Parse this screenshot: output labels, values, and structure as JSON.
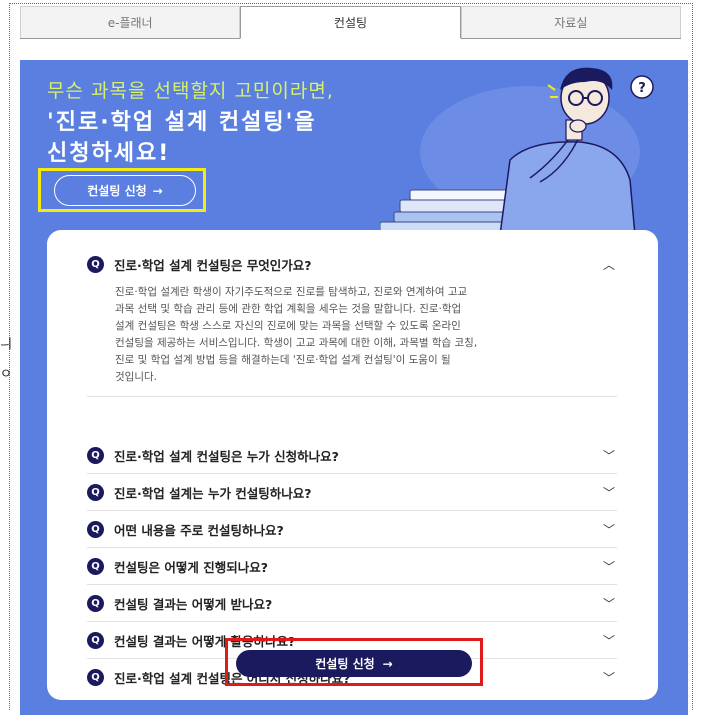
{
  "tabs": [
    {
      "label": "e-플래너"
    },
    {
      "label": "컨설팅"
    },
    {
      "label": "자료실"
    }
  ],
  "side_glyphs": [
    "ㅢ",
    "ㅇ"
  ],
  "hero": {
    "line1": "무슨 과목을 선택할지 고민이라면,",
    "line2": "'진로·학업 설계 컨설팅'을",
    "line3": "신청하세요!",
    "cta_label": "컨설팅 신청",
    "cta_arrow": "→",
    "bubble": "?"
  },
  "faq": {
    "badge": "Q",
    "items": [
      {
        "question": "진로·학업 설계 컨설팅은 무엇인가요?",
        "expanded": true,
        "answer": "진로·학업 설계란 학생이 자기주도적으로 진로를 탐색하고, 진로와 연계하여 고교\n과목 선택 및 학습 관리 등에 관한 학업 계획을 세우는 것을 말합니다. 진로·학업\n설계 컨설팅은 학생 스스로 자신의 진로에 맞는 과목을 선택할 수 있도록 온라인\n컨설팅을 제공하는 서비스입니다. 학생이 고교 과목에 대한 이해, 과목별 학습 코칭,\n진로 및 학업 설계 방법 등을 해결하는데 '진로·학업 설계 컨설팅'이 도움이 될\n것입니다."
      },
      {
        "question": "진로·학업 설계 컨설팅은 누가 신청하나요?"
      },
      {
        "question": "진로·학업 설계는 누가 컨설팅하나요?"
      },
      {
        "question": "어떤 내용을 주로 컨설팅하나요?"
      },
      {
        "question": "컨설팅은 어떻게 진행되나요?"
      },
      {
        "question": "컨설팅 결과는 어떻게 받나요?"
      },
      {
        "question": "컨설팅 결과는 어떻게 활용하나요?"
      },
      {
        "question": "진로·학업 설계 컨설팅은 어디서 신청하나요?"
      }
    ],
    "chevron_up": "︿",
    "chevron_down": "﹀"
  },
  "bottom_cta": {
    "label": "컨설팅 신청",
    "arrow": "→"
  },
  "colors": {
    "panel": "#5b7fe0",
    "navy": "#1c1a5e",
    "highlight_yellow": "#f2ea10",
    "highlight_red": "#e01919",
    "hero_yellow": "#d8f06a"
  }
}
